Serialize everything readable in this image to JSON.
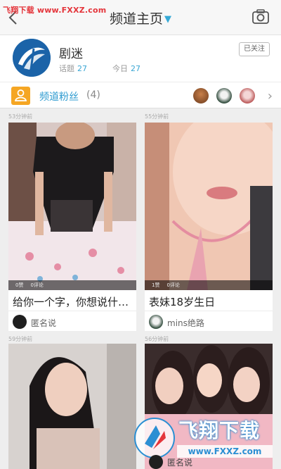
{
  "header": {
    "watermark": "飞翔下载 www.FXXZ.com",
    "title": "频道主页"
  },
  "channel": {
    "name": "剧迷",
    "topics_label": "话题",
    "topics_value": "27",
    "today_label": "今日",
    "today_value": "27",
    "follow_label": "已关注"
  },
  "fans": {
    "title": "频道粉丝",
    "count": "(4)"
  },
  "posts": [
    {
      "time": "53分钟前",
      "likes": "0赞",
      "comments": "0评论",
      "title": "给你一个字，你想说什…",
      "author": "匿名说"
    },
    {
      "time": "55分钟前",
      "likes": "1赞",
      "comments": "0评论",
      "title": "表妹18岁生日",
      "author": "mins绝路"
    },
    {
      "time": "59分钟前",
      "author": ""
    },
    {
      "time": "56分钟前",
      "author": "匿名说"
    }
  ],
  "watermark_bottom": {
    "brand": "飞翔下载",
    "url": "www.FXXZ.com"
  },
  "colors": {
    "accent": "#35a9d6",
    "brand_red": "#e4353b",
    "fans_icon": "#f5a623"
  }
}
